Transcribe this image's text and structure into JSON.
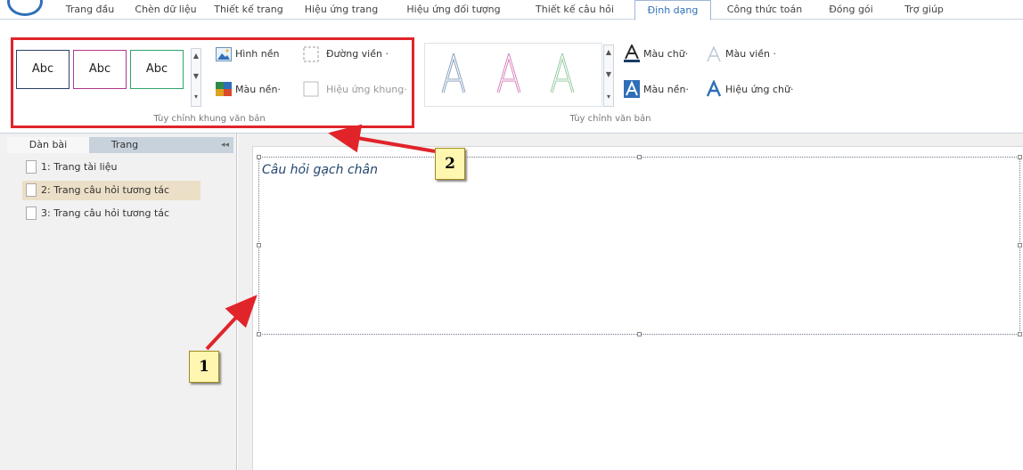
{
  "ribbon_tabs": [
    "Trang đầu",
    "Chèn dữ liệu",
    "Thiết kế trang",
    "Hiệu ứng trang",
    "Hiệu ứng đối tượng",
    "Thiết kế câu hỏi",
    "Định dạng",
    "Công thức toán",
    "Đóng gói",
    "Trợ giúp"
  ],
  "active_tab": "Định dạng",
  "frame_group": {
    "style_previews": [
      "Abc",
      "Abc",
      "Abc"
    ],
    "background_image": "Hình nền",
    "border": "Đường viền",
    "background_color": "Màu nền",
    "frame_effect": "Hiệu ứng khung",
    "group_label": "Tùy chỉnh khung văn bản"
  },
  "text_group": {
    "text_color": "Màu chữ",
    "outline_color": "Màu viền",
    "highlight_color": "Màu nền",
    "text_effect": "Hiệu ứng chữ",
    "group_label": "Tùy chỉnh văn bản"
  },
  "left_panel": {
    "tabs": [
      "Dàn bài",
      "Trang"
    ],
    "collapse_glyph": "◂◂",
    "slides": [
      "1: Trang tài liệu",
      "2: Trang câu hỏi tương tác",
      "3: Trang câu hỏi tương tác"
    ]
  },
  "canvas": {
    "textbox_text": "Câu hỏi gạch chân"
  },
  "annotations": {
    "callout_1": "1",
    "callout_2": "2"
  },
  "colors": {
    "accent": "#2f6fb8",
    "annotation_red": "#e0242a",
    "callout_fill": "#fff6b0",
    "selected_slide": "#ecdfc7"
  },
  "dropdown_glyph": "·",
  "scroll_glyphs": {
    "up": "▲",
    "down": "▼",
    "more": "▾"
  }
}
